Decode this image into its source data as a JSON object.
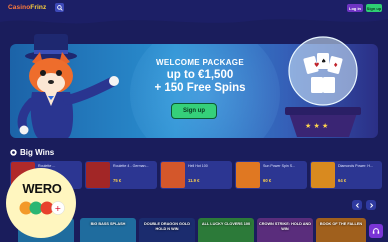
{
  "header": {
    "logo_part1": "Casino",
    "logo_part2": "Frinz",
    "login_label": "Log in",
    "signup_label": "Sign up"
  },
  "promo": {
    "title": "WELCOME PACKAGE",
    "line1": "up to €1,500",
    "line2": "+ 150 Free Spins",
    "button_label": "Sign up"
  },
  "big_wins": {
    "title": "Big Wins",
    "items": [
      {
        "game": "Roulette ...",
        "amount": "",
        "color": "#b02a2a"
      },
      {
        "game": "Roulette 4 - German...",
        "amount": "75 €",
        "color": "#a22626"
      },
      {
        "game": "Hell Hot 100",
        "amount": "11.9 €",
        "color": "#d4572b"
      },
      {
        "game": "Sun Power Spin S...",
        "amount": "60 €",
        "color": "#e07822"
      },
      {
        "game": "Diamonds Power: H...",
        "amount": "64 €",
        "color": "#d98a1f"
      }
    ]
  },
  "wero": {
    "text": "WERO"
  },
  "games": [
    {
      "label": "BIG BASS SPLASH",
      "color": "#1f6c9e"
    },
    {
      "label": "DOUBLE DRAGON GOLD HOLD N WIN",
      "color": "#1b2c6e"
    },
    {
      "label": "ALL LUCKY CLOVERS 100",
      "color": "#2c7a39"
    },
    {
      "label": "CROWN STRIKE: HOLD AND WIN",
      "color": "#5a2d7c"
    },
    {
      "label": "BOOK OF THE FALLEN",
      "color": "#a0601d"
    }
  ]
}
